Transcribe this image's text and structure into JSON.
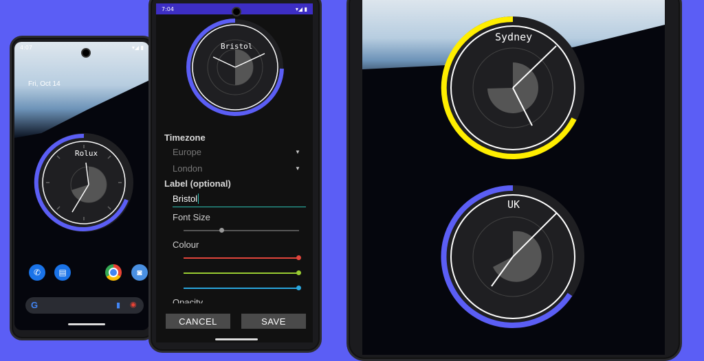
{
  "phone_left": {
    "status": {
      "time": "4:07",
      "icons": [
        "gear-icon",
        "wifi-icon",
        "signal-icon",
        "battery-icon"
      ]
    },
    "date_text": "Fri, Oct 14",
    "widget_label": "Rolux",
    "dock": [
      "phone-icon",
      "messages-icon",
      "chrome-icon",
      "camera-icon"
    ],
    "search_bar": {
      "g_icon": "google-g-icon",
      "mic_icon": "mic-icon",
      "lens_icon": "lens-icon"
    }
  },
  "phone_middle": {
    "status": {
      "time": "7:04"
    },
    "preview_label": "Bristol",
    "timezone_header": "Timezone",
    "region_value": "Europe",
    "city_value": "London",
    "label_header": "Label (optional)",
    "label_input_value": "Bristol",
    "font_size_label": "Font Size",
    "font_size_value": 0.5,
    "colour_label": "Colour",
    "colour": {
      "red": 1.0,
      "green": 1.0,
      "blue": 1.0
    },
    "opacity_label": "Opacity",
    "cancel_label": "CANCEL",
    "save_label": "SAVE"
  },
  "phone_right": {
    "clock1_label": "Sydney",
    "clock2_label": "UK"
  },
  "colors": {
    "background": "#5b5ef5",
    "accent": "#5b5ef5",
    "yellow": "#ffee00",
    "red": "#e2453c",
    "green": "#9acd32",
    "blue": "#2aa8e0"
  }
}
